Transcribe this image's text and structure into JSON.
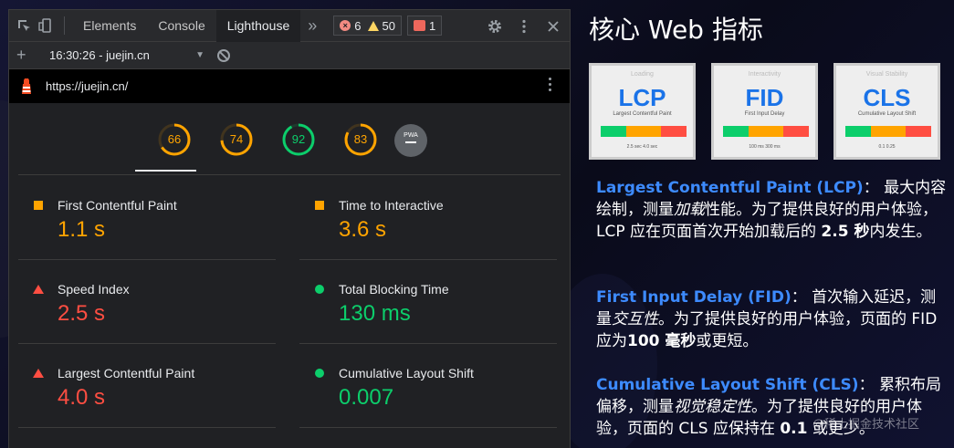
{
  "devtools": {
    "tabs": [
      "Elements",
      "Console",
      "Lighthouse"
    ],
    "active_tab": "Lighthouse",
    "more_tabs": "»",
    "errors": "6",
    "warnings": "50",
    "issues": "1",
    "report_label": "16:30:26 - juejin.cn",
    "url": "https://juejin.cn/",
    "scores": [
      {
        "value": "66",
        "level": 0.66,
        "color": "#ffa400"
      },
      {
        "value": "74",
        "level": 0.74,
        "color": "#ffa400"
      },
      {
        "value": "92",
        "level": 0.92,
        "color": "#0cce6b"
      },
      {
        "value": "83",
        "level": 0.83,
        "color": "#ffa400"
      }
    ],
    "pwa_label": "PWA",
    "metrics": [
      {
        "label": "First Contentful Paint",
        "value": "1.1 s",
        "status": "orange"
      },
      {
        "label": "Time to Interactive",
        "value": "3.6 s",
        "status": "orange"
      },
      {
        "label": "Speed Index",
        "value": "2.5 s",
        "status": "red"
      },
      {
        "label": "Total Blocking Time",
        "value": "130 ms",
        "status": "green"
      },
      {
        "label": "Largest Contentful Paint",
        "value": "4.0 s",
        "status": "red"
      },
      {
        "label": "Cumulative Layout Shift",
        "value": "0.007",
        "status": "green"
      }
    ]
  },
  "slide": {
    "title": "核心 Web 指标",
    "thumbs": [
      {
        "kicker": "Loading",
        "acronym": "LCP",
        "name": "Largest Contentful Paint",
        "ticks": "2.5 sec        4.0 sec"
      },
      {
        "kicker": "Interactivity",
        "acronym": "FID",
        "name": "First Input Delay",
        "ticks": "100 ms       300 ms"
      },
      {
        "kicker": "Visual Stability",
        "acronym": "CLS",
        "name": "Cumulative Layout Shift",
        "ticks": "0.1          0.25"
      }
    ],
    "paragraphs": [
      {
        "term": "Largest Contentful Paint (LCP)",
        "colon": "：",
        "pre": " 最大内容绘制，测量",
        "em": "加载",
        "mid": "性能。为了提供良好的用户体验，LCP 应在页面首次开始加载后的 ",
        "strong": "2.5 秒",
        "post": "内发生。"
      },
      {
        "term": "First Input Delay (FID)",
        "colon": "：",
        "pre": " 首次输入延迟，测量",
        "em": "交互性",
        "mid": "。为了提供良好的用户体验，页面的 FID 应为",
        "strong": "100 毫秒",
        "post": "或更短。"
      },
      {
        "term": "Cumulative Layout Shift (CLS)",
        "colon": "：",
        "pre": " 累积布局偏移，测量",
        "em": "视觉稳定性",
        "mid": "。为了提供良好的用户体验，页面的 CLS 应保持在 ",
        "strong": "0.1",
        "post": " 或更少。"
      }
    ],
    "watermark": "@稀土掘金技术社区"
  }
}
